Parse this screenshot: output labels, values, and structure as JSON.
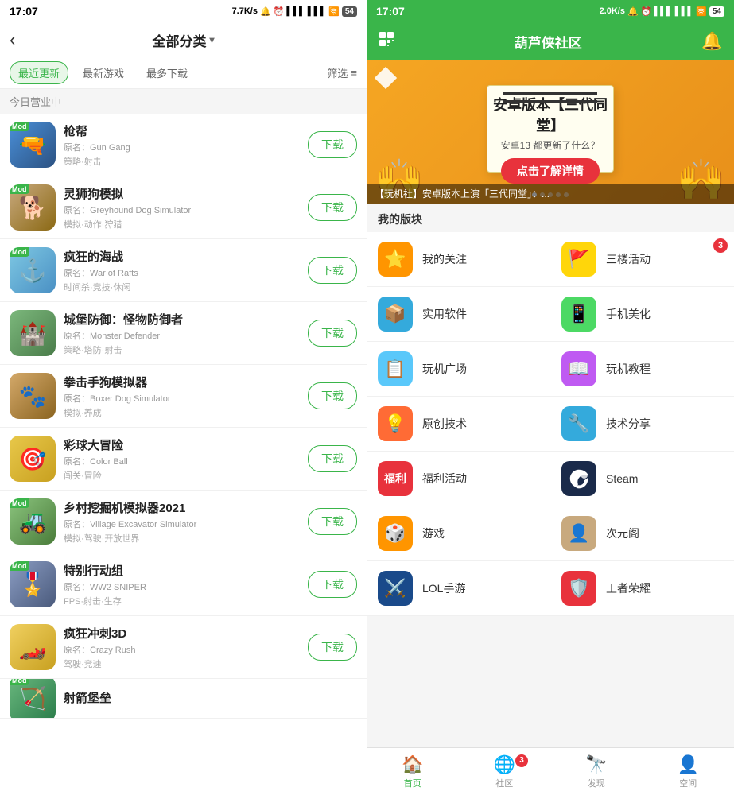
{
  "left": {
    "statusBar": {
      "time": "17:07",
      "networkSpeed": "7.7K/s",
      "icons": "🔔 ⏰ 📶 📶 🛜 54"
    },
    "header": {
      "backLabel": "‹",
      "title": "全部分类",
      "arrowDown": "▾"
    },
    "filterTabs": [
      {
        "label": "最近更新",
        "active": true
      },
      {
        "label": "最新游戏",
        "active": false
      },
      {
        "label": "最多下载",
        "active": false
      }
    ],
    "filterLabel": "筛选",
    "sectionHeader": "今日营业中",
    "downloadLabel": "下载",
    "games": [
      {
        "id": 1,
        "title": "枪帮",
        "original": "原名：Gun Gang",
        "tags": "策略·射击",
        "hasMod": true,
        "bgClass": "bg-gungang",
        "emoji": "🔫"
      },
      {
        "id": 2,
        "title": "灵狮狗模拟",
        "original": "原名：Greyhound Dog Simulator",
        "tags": "模拟·动作·狩猎",
        "hasMod": true,
        "bgClass": "bg-greyhound",
        "emoji": "🐕"
      },
      {
        "id": 3,
        "title": "疯狂的海战",
        "original": "原名：War of Rafts",
        "tags": "时间杀·竞技·休闲",
        "hasMod": true,
        "bgClass": "bg-rafts",
        "emoji": "⚓"
      },
      {
        "id": 4,
        "title": "城堡防御：怪物防御者",
        "original": "原名：Monster Defender",
        "tags": "策略·塔防·射击",
        "hasMod": false,
        "bgClass": "bg-monster",
        "emoji": "🏰"
      },
      {
        "id": 5,
        "title": "拳击手狗模拟器",
        "original": "原名：Boxer Dog Simulator",
        "tags": "模拟·养成",
        "hasMod": false,
        "bgClass": "bg-boxer",
        "emoji": "🐾"
      },
      {
        "id": 6,
        "title": "彩球大冒险",
        "original": "原名：Color Ball",
        "tags": "闯关·冒险",
        "hasMod": false,
        "bgClass": "bg-colorball",
        "emoji": "🎯"
      },
      {
        "id": 7,
        "title": "乡村挖掘机模拟器2021",
        "original": "原名：Village Excavator Simulator",
        "tags": "模拟·驾驶·开放世界",
        "hasMod": true,
        "bgClass": "bg-village",
        "emoji": "🚜"
      },
      {
        "id": 8,
        "title": "特别行动组",
        "original": "原名：WW2 SNIPER",
        "tags": "FPS·射击·生存",
        "hasMod": true,
        "bgClass": "bg-ww2",
        "emoji": "🎖️"
      },
      {
        "id": 9,
        "title": "疯狂冲刺3D",
        "original": "原名：Crazy Rush",
        "tags": "驾驶·竞速",
        "hasMod": false,
        "bgClass": "bg-crazy",
        "emoji": "🏎️"
      },
      {
        "id": 10,
        "title": "射箭堡垒",
        "original": "",
        "tags": "",
        "hasMod": true,
        "bgClass": "bg-rocket",
        "emoji": "🏹"
      }
    ]
  },
  "right": {
    "statusBar": {
      "time": "17:07",
      "networkSpeed": "2.0K/s",
      "icons": "🔔 ⏰ 📶 📶 🛜 54"
    },
    "header": {
      "gridIcon": "⊞",
      "title": "葫芦侠社区",
      "bellIcon": "🔔"
    },
    "banner": {
      "title": "安卓版本【三代同堂】",
      "subtitle": "安卓13 都更新了什么？",
      "btnLabel": "点击了解详情",
      "caption": "【玩机社】安卓版本上演「三代同堂」：...",
      "dots": [
        true,
        false,
        false,
        false,
        false
      ]
    },
    "sectionLabel": "我的版块",
    "blocks": [
      {
        "label": "我的关注",
        "iconClass": "bi-follow",
        "emoji": "⭐",
        "badge": null
      },
      {
        "label": "三楼活动",
        "iconClass": "bi-floor",
        "emoji": "🚩",
        "badge": "3"
      },
      {
        "label": "实用软件",
        "iconClass": "bi-software",
        "emoji": "📦",
        "badge": null
      },
      {
        "label": "手机美化",
        "iconClass": "bi-beauty",
        "emoji": "📱",
        "badge": null
      },
      {
        "label": "玩机广场",
        "iconClass": "bi-arcade",
        "emoji": "📋",
        "badge": null
      },
      {
        "label": "玩机教程",
        "iconClass": "bi-tutorial",
        "emoji": "📖",
        "badge": null
      },
      {
        "label": "原创技术",
        "iconClass": "bi-tech",
        "emoji": "💡",
        "badge": null
      },
      {
        "label": "技术分享",
        "iconClass": "bi-techshare",
        "emoji": "🔧",
        "badge": null
      },
      {
        "label": "福利活动",
        "iconClass": "bi-welfare",
        "emoji": "🎁",
        "badge": null
      },
      {
        "label": "Steam",
        "iconClass": "bi-steam",
        "emoji": "🎮",
        "badge": null
      },
      {
        "label": "游戏",
        "iconClass": "bi-game",
        "emoji": "🎲",
        "badge": null
      },
      {
        "label": "次元阁",
        "iconClass": "bi-anime",
        "emoji": "👤",
        "badge": null
      },
      {
        "label": "LOL手游",
        "iconClass": "bi-lol",
        "emoji": "⚔️",
        "badge": null
      },
      {
        "label": "王者荣耀",
        "iconClass": "bi-king",
        "emoji": "🛡️",
        "badge": null
      }
    ],
    "bottomNav": [
      {
        "label": "首页",
        "emoji": "🏠",
        "active": true,
        "badge": null
      },
      {
        "label": "社区",
        "emoji": "🌐",
        "active": false,
        "badge": "3"
      },
      {
        "label": "发现",
        "emoji": "🔭",
        "active": false,
        "badge": null
      },
      {
        "label": "空间",
        "emoji": "👤",
        "active": false,
        "badge": null
      }
    ]
  }
}
